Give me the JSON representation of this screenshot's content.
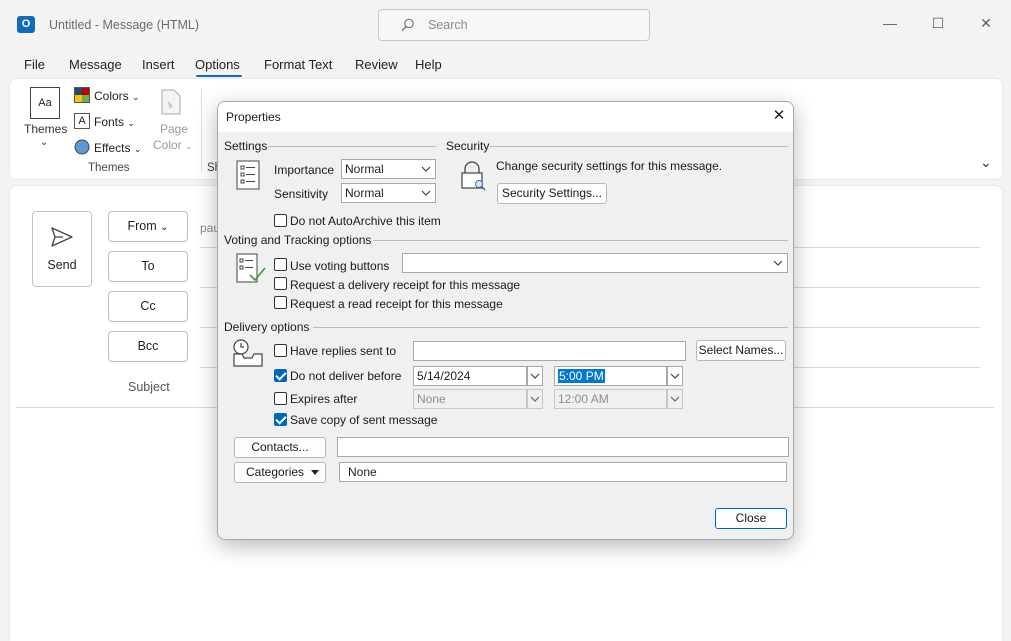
{
  "window": {
    "title": "Untitled  -  Message (HTML)",
    "app_icon_letter": "O",
    "search_placeholder": "Search",
    "minimize": "—",
    "maximize": "☐",
    "close": "✕"
  },
  "menu": {
    "items": [
      "File",
      "Message",
      "Insert",
      "Options",
      "Format Text",
      "Review",
      "Help"
    ],
    "active": "Options"
  },
  "ribbon": {
    "themes_label": "Themes",
    "themes_icon_text": "Aa",
    "colors_label": "Colors",
    "fonts_label": "Fonts",
    "effects_label": "Effects",
    "page_color_label_1": "Page",
    "page_color_label_2": "Color",
    "group_themes": "Themes",
    "group_show_partial": "Sh",
    "expand_glyph": "⌄"
  },
  "compose": {
    "send_label": "Send",
    "from_label": "From",
    "from_value_peek": "pau",
    "to_label": "To",
    "cc_label": "Cc",
    "bcc_label": "Bcc",
    "subject_label": "Subject"
  },
  "dialog": {
    "title": "Properties",
    "settings": {
      "heading": "Settings",
      "importance_label": "Importance",
      "importance_value": "Normal",
      "sensitivity_label": "Sensitivity",
      "sensitivity_value": "Normal",
      "no_autoarchive_label": "Do not AutoArchive this item",
      "no_autoarchive_checked": false
    },
    "security": {
      "heading": "Security",
      "description": "Change security settings for this message.",
      "button_label": "Security Settings..."
    },
    "voting": {
      "heading": "Voting and Tracking options",
      "use_voting_label": "Use voting buttons",
      "use_voting_checked": false,
      "voting_value": "",
      "delivery_receipt_label": "Request a delivery receipt for this message",
      "delivery_receipt_checked": false,
      "read_receipt_label": "Request a read receipt for this message",
      "read_receipt_checked": false
    },
    "delivery": {
      "heading": "Delivery options",
      "have_replies_label": "Have replies sent to",
      "have_replies_checked": false,
      "have_replies_value": "",
      "select_names_label": "Select Names...",
      "do_not_deliver_label": "Do not deliver before",
      "do_not_deliver_checked": true,
      "deliver_date": "5/14/2024",
      "deliver_time": "5:00 PM",
      "expires_label": "Expires after",
      "expires_checked": false,
      "expires_date": "None",
      "expires_time": "12:00 AM",
      "save_copy_label": "Save copy of sent message",
      "save_copy_checked": true
    },
    "contacts_button": "Contacts...",
    "contacts_value": "",
    "categories_button": "Categories",
    "categories_value": "None",
    "close_button": "Close",
    "close_icon": "✕"
  },
  "colors": {
    "accent": "#0f6cbd",
    "checkbox_checked": "#0067c0",
    "selection": "#0078d4"
  }
}
